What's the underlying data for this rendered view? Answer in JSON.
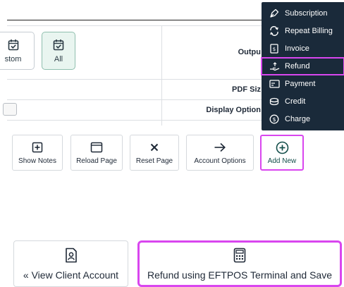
{
  "filters": [
    {
      "id": "custom",
      "label": "stom",
      "icon": "calendar-check-icon"
    },
    {
      "id": "all",
      "label": "All",
      "icon": "calendar-check-icon"
    }
  ],
  "form_rows": {
    "output_label": "Outpu",
    "pdf_size_label": "PDF Siz",
    "display_options_label": "Display Option"
  },
  "dropdown": {
    "items": [
      {
        "label": "Subscription",
        "icon": "pen-nib-icon"
      },
      {
        "label": "Repeat Billing",
        "icon": "repeat-icon"
      },
      {
        "label": "Invoice",
        "icon": "invoice-icon"
      },
      {
        "label": "Refund",
        "icon": "refund-hand-icon",
        "highlighted": true
      },
      {
        "label": "Payment",
        "icon": "card-icon"
      },
      {
        "label": "Credit",
        "icon": "coins-icon"
      },
      {
        "label": "Charge",
        "icon": "dollar-circle-icon"
      }
    ]
  },
  "actions": [
    {
      "label": "Show Notes",
      "icon": "plus-square-icon"
    },
    {
      "label": "Reload Page",
      "icon": "window-icon"
    },
    {
      "label": "Reset Page",
      "icon": "x-icon"
    },
    {
      "label": "Account Options",
      "icon": "arrow-right-icon"
    },
    {
      "label": "Add New",
      "icon": "plus-circle-icon",
      "highlighted": true
    }
  ],
  "bottom_buttons": {
    "view_client": "« View Client Account",
    "refund_eftpos": "Refund using EFTPOS Terminal and Save"
  },
  "colors": {
    "dropdown_bg": "#1a2a3a",
    "highlight": "#d946ef",
    "all_filter_bg": "#e9f5f0",
    "teal_text": "#134e4a"
  }
}
